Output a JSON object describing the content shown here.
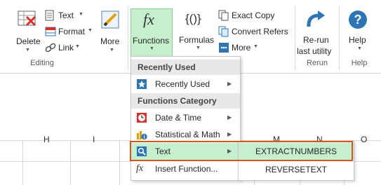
{
  "ribbon": {
    "editing": {
      "delete_label": "Delete",
      "text_label": "Text",
      "format_label": "Format",
      "link_label": "Link",
      "more_label": "More",
      "group_label": "Editing"
    },
    "functions_label": "Functions",
    "formulas_label": "Formulas",
    "formula_tools": {
      "exact_copy_label": "Exact Copy",
      "convert_refers_label": "Convert Refers",
      "more_label": "More"
    },
    "rerun": {
      "label_line1": "Re-run",
      "label_line2": "last utility",
      "group_label": "Rerun"
    },
    "help": {
      "label": "Help",
      "group_label": "Help"
    },
    "icon_text": {
      "fx": "fx",
      "braces": "{()}",
      "question": "?"
    }
  },
  "sheet": {
    "columns": [
      "H",
      "I",
      "M",
      "N",
      "O"
    ]
  },
  "menu": {
    "recently_used_header": "Recently Used",
    "recently_used_item": "Recently Used",
    "functions_category_header": "Functions Category",
    "items": [
      {
        "label": "Date & Time",
        "icon": "clock-icon"
      },
      {
        "label": "Statistical & Math",
        "icon": "chart-info-icon"
      },
      {
        "label": "Text",
        "icon": "search-text-icon"
      },
      {
        "label": "Insert Function...",
        "icon": "fx-icon"
      }
    ]
  },
  "submenu": {
    "items": [
      "EXTRACTNUMBERS",
      "REVERSETEXT"
    ]
  },
  "colors": {
    "accent_green": "#c6efce",
    "highlight_red": "#d9531e",
    "help_blue": "#2e75b6"
  }
}
